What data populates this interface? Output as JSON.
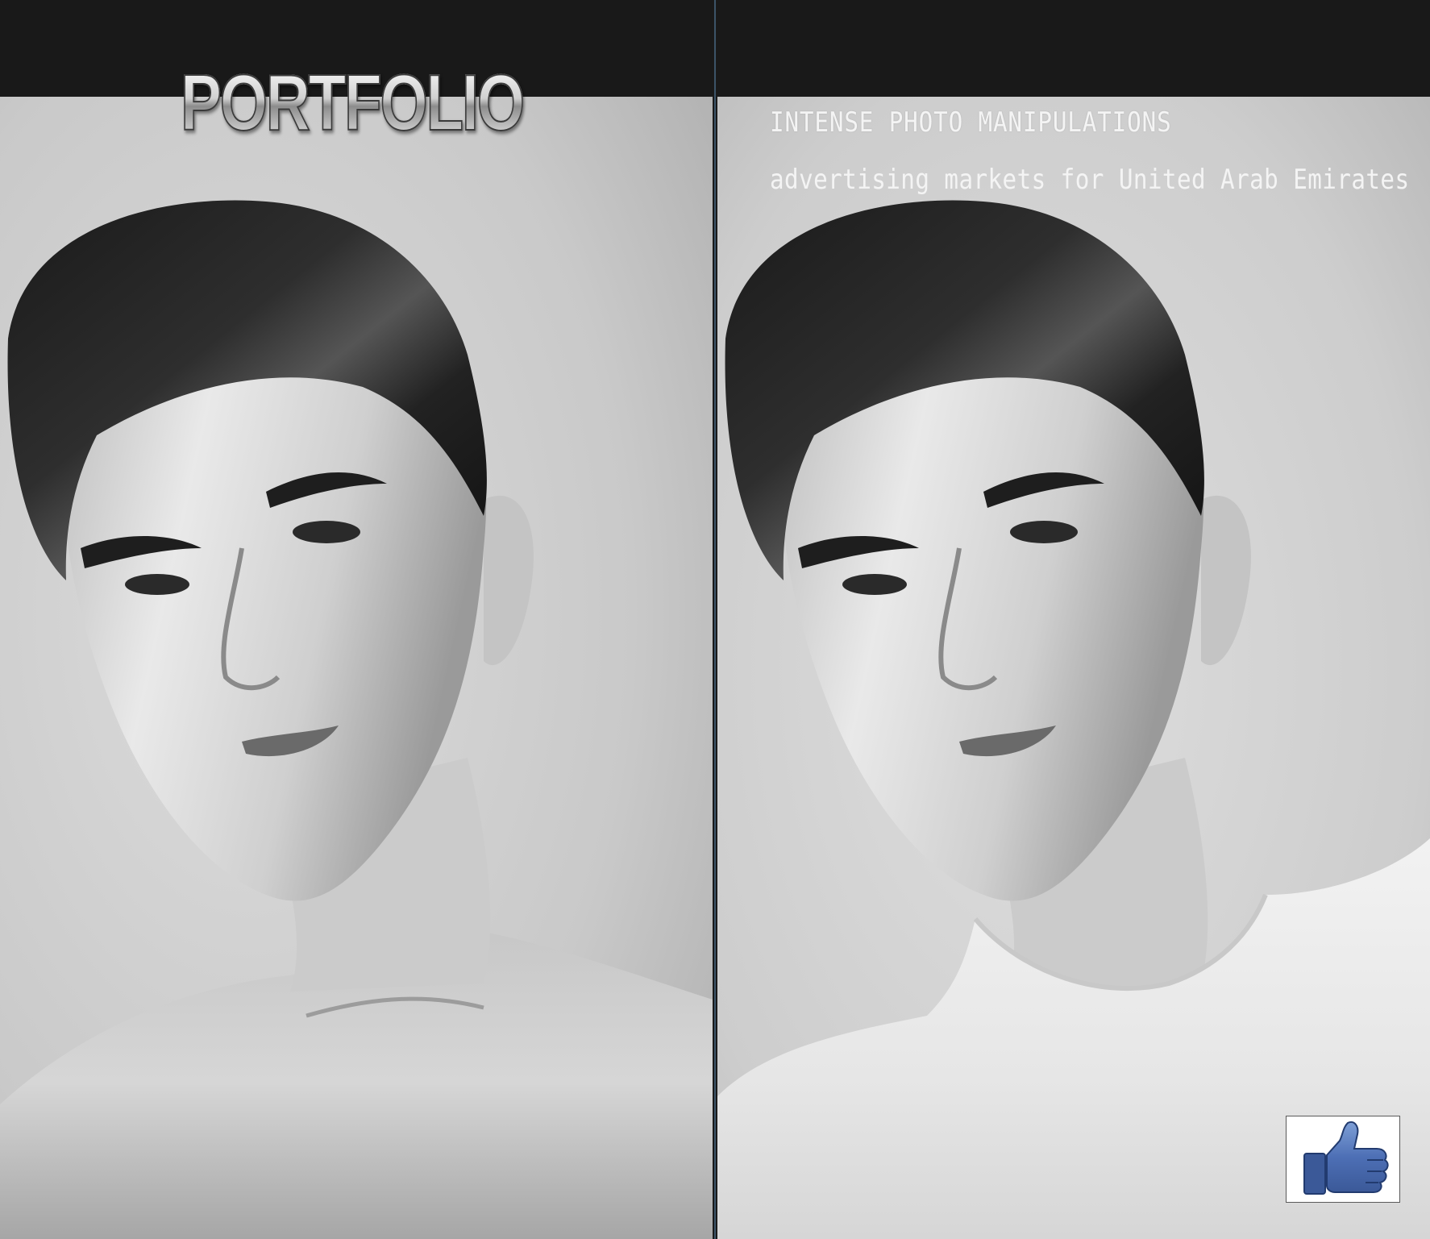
{
  "portfolio": {
    "title": "PORTFOLIO"
  },
  "headline": {
    "line1": "Intense photo manipulations",
    "line2": "advertising markets for United Arab Emirates"
  },
  "like_button": {
    "icon": "thumbs-up-icon",
    "color": "#3b5998"
  },
  "photos": {
    "left": "shirtless-portrait",
    "right": "t-shirt-portrait"
  },
  "colors": {
    "background": "#191919",
    "divider": "#3c5468",
    "text": "#f4f4f4"
  }
}
